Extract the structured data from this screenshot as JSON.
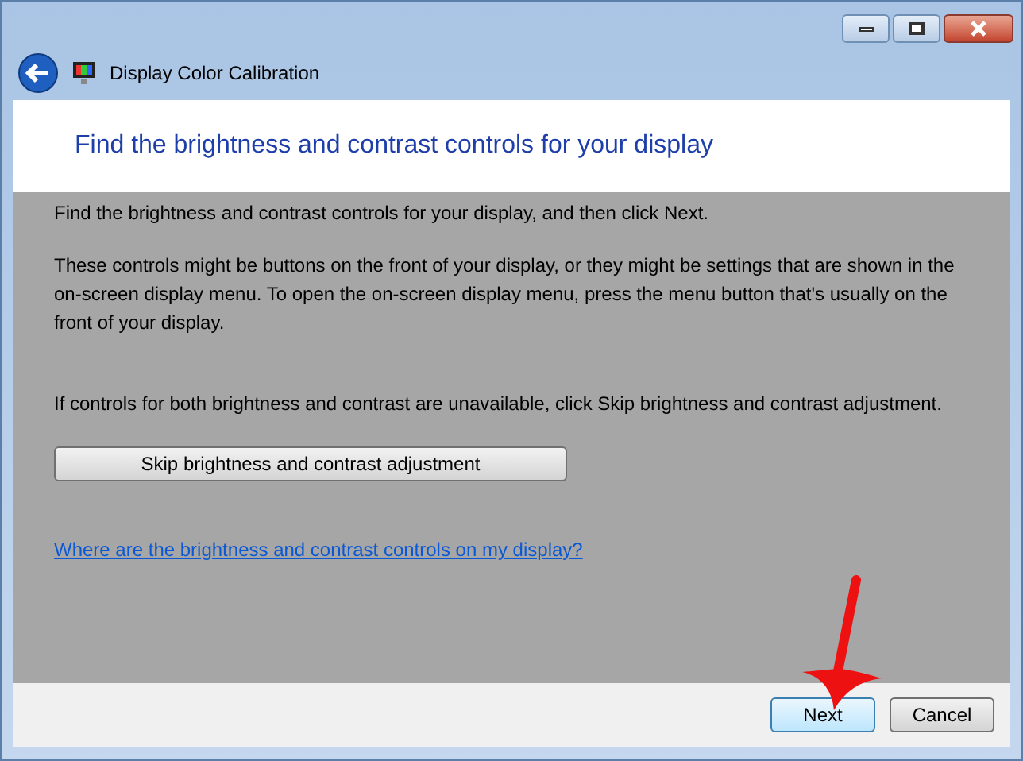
{
  "window": {
    "title": "Display Color Calibration"
  },
  "heading": "Find the brightness and contrast controls for your display",
  "paragraphs": [
    "Find the brightness and contrast controls for your display, and then click Next.",
    "These controls might be buttons on the front of your display, or they might be settings that are shown in the on-screen display menu. To open the on-screen display menu, press the menu button that's usually on the front of your display.",
    "If controls for both brightness and contrast are unavailable, click Skip brightness and contrast adjustment."
  ],
  "skip_button": "Skip brightness and contrast adjustment",
  "help_link": "Where are the brightness and contrast controls on my display?",
  "buttons": [
    {
      "label": "Next",
      "selected": true
    },
    {
      "label": "Cancel",
      "selected": false
    }
  ],
  "annotation": {
    "kind": "arrow"
  }
}
